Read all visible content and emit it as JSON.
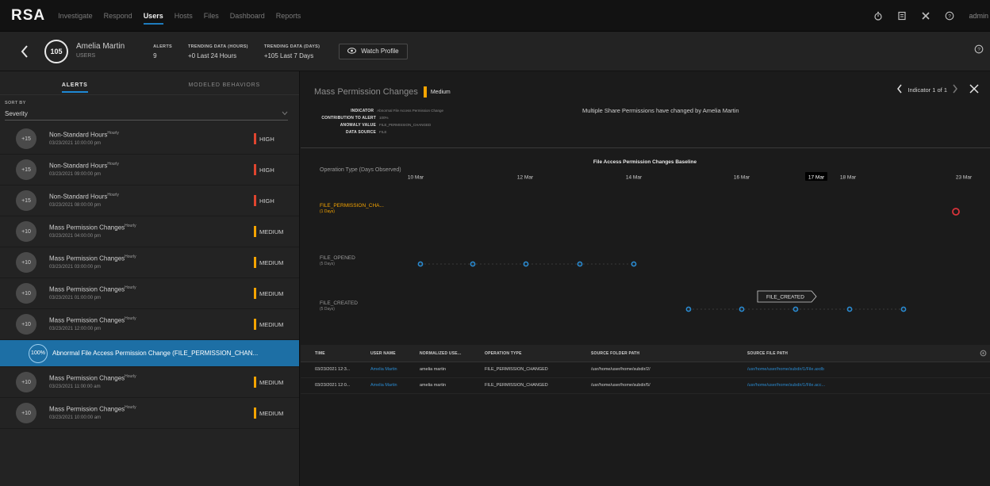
{
  "nav": {
    "logo": "RSA",
    "items": [
      "Investigate",
      "Respond",
      "Users",
      "Hosts",
      "Files",
      "Dashboard",
      "Reports"
    ],
    "active": "Users",
    "user": "admin",
    "icons": [
      "timer-icon",
      "report-icon",
      "tools-icon",
      "help-icon"
    ]
  },
  "profile": {
    "score": "105",
    "name": "Amelia Martin",
    "type": "USERS",
    "stats": [
      {
        "label": "ALERTS",
        "value": "9"
      },
      {
        "label": "TRENDING DATA (HOURS)",
        "value": "+0 Last 24 Hours"
      },
      {
        "label": "TRENDING DATA (DAYS)",
        "value": "+105 Last 7 Days"
      }
    ],
    "watch_label": "Watch Profile"
  },
  "left": {
    "tabs": [
      "ALERTS",
      "MODELED BEHAVIORS"
    ],
    "sort_label": "SORT BY",
    "sort_value": "Severity",
    "alerts": [
      {
        "score": "+15",
        "title": "Non-Standard Hours",
        "freq": "Hourly",
        "date": "03/23/2021 10:00:00 pm",
        "severity": "HIGH"
      },
      {
        "score": "+15",
        "title": "Non-Standard Hours",
        "freq": "Hourly",
        "date": "03/23/2021 09:00:00 pm",
        "severity": "HIGH"
      },
      {
        "score": "+15",
        "title": "Non-Standard Hours",
        "freq": "Hourly",
        "date": "03/23/2021 08:00:00 pm",
        "severity": "HIGH"
      },
      {
        "score": "+10",
        "title": "Mass Permission Changes",
        "freq": "Hourly",
        "date": "03/23/2021 04:00:00 pm",
        "severity": "MEDIUM"
      },
      {
        "score": "+10",
        "title": "Mass Permission Changes",
        "freq": "Hourly",
        "date": "03/23/2021 03:00:00 pm",
        "severity": "MEDIUM"
      },
      {
        "score": "+10",
        "title": "Mass Permission Changes",
        "freq": "Hourly",
        "date": "03/23/2021 01:00:00 pm",
        "severity": "MEDIUM"
      },
      {
        "score": "+10",
        "title": "Mass Permission Changes",
        "freq": "Hourly",
        "date": "03/23/2021 12:00:00 pm",
        "severity": "MEDIUM"
      }
    ],
    "selected": {
      "score": "100%",
      "text": "Abnormal File Access Permission Change (FILE_PERMISSION_CHAN..."
    },
    "alerts_after": [
      {
        "score": "+10",
        "title": "Mass Permission Changes",
        "freq": "Hourly",
        "date": "03/23/2021 11:00:00 am",
        "severity": "MEDIUM"
      },
      {
        "score": "+10",
        "title": "Mass Permission Changes",
        "freq": "Hourly",
        "date": "03/23/2021 10:00:00 am",
        "severity": "MEDIUM"
      }
    ],
    "colors": {
      "HIGH": "#e0452f",
      "MEDIUM": "#f5a400"
    }
  },
  "right": {
    "title": "Mass Permission Changes",
    "severity": "Medium",
    "indicator_nav": "Indicator 1 of 1",
    "details": [
      {
        "k": "INDICATOR",
        "v": "Abnormal File Access Permission Change"
      },
      {
        "k": "CONTRIBUTION TO ALERT",
        "v": "100%"
      },
      {
        "k": "ANOMALY VALUE",
        "v": "FILE_PERMISSION_CHANGED"
      },
      {
        "k": "DATA SOURCE",
        "v": "FILE"
      }
    ],
    "description": "Multiple Share Permissions have changed by Amelia Martin"
  },
  "chart_data": {
    "type": "scatter",
    "title": "File Access Permission Changes Baseline",
    "ylabel": "Operation Type (Days Observed)",
    "x_ticks": [
      "10 Mar",
      "12 Mar",
      "14 Mar",
      "16 Mar",
      "17 Mar",
      "18 Mar",
      "23 Mar"
    ],
    "highlight_tick": "17 Mar",
    "series": [
      {
        "name": "FILE_PERMISSION_CHA...",
        "days": "(1 Days)",
        "color": "#d8333a",
        "dates": [
          "23 Mar"
        ]
      },
      {
        "name": "FILE_OPENED",
        "days": "(5 Days)",
        "color": "#2a8ad0",
        "dates": [
          "10 Mar",
          "11 Mar",
          "12 Mar",
          "13 Mar",
          "14 Mar"
        ]
      },
      {
        "name": "FILE_CREATED",
        "days": "(5 Days)",
        "color": "#2a8ad0",
        "dates": [
          "15 Mar",
          "16 Mar",
          "17 Mar",
          "18 Mar",
          "19 Mar"
        ]
      }
    ],
    "tooltip": "FILE_CREATED"
  },
  "table": {
    "headers": [
      "TIME",
      "USER NAME",
      "NORMALIZED USE...",
      "OPERATION TYPE",
      "SOURCE FOLDER PATH",
      "SOURCE FILE PATH"
    ],
    "rows": [
      [
        "03/23/2021 12:3...",
        "Amelia Martin",
        "amelia martin",
        "FILE_PERMISSION_CHANGED",
        "/usr/home/user/home/subdir/2/",
        "/usr/home/user/home/subdir/1/File.axdb"
      ],
      [
        "03/23/2021 12:0...",
        "Amelia Martin",
        "amelia martin",
        "FILE_PERMISSION_CHANGED",
        "/usr/home/user/home/subdir/5/",
        "/usr/home/user/home/subdir/1/File.acc..."
      ]
    ]
  }
}
